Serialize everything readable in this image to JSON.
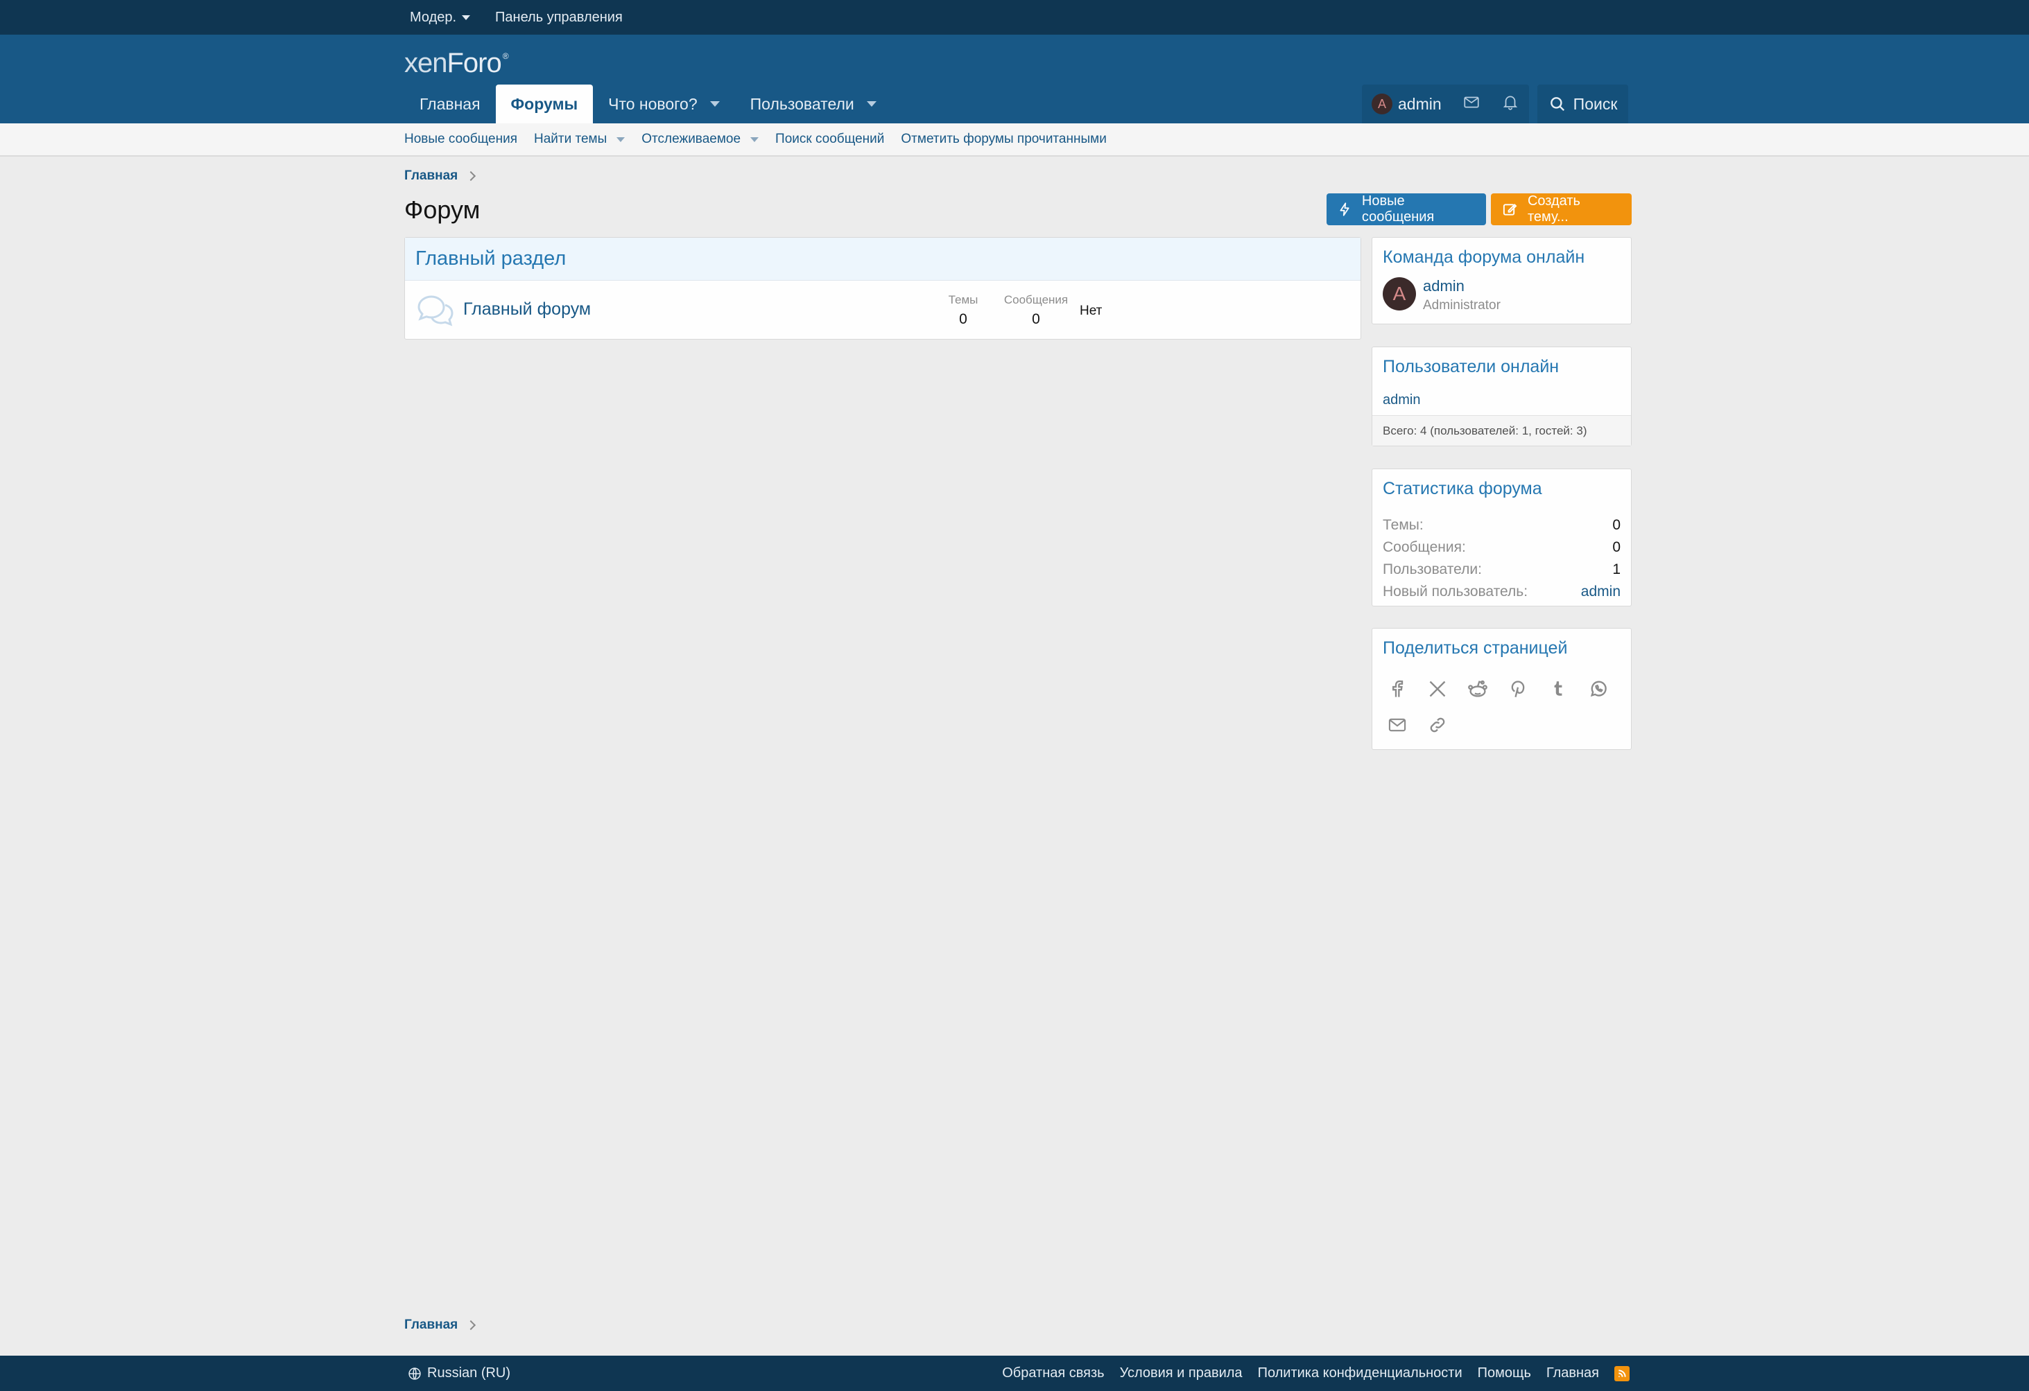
{
  "staff_bar": {
    "moderator": "Модер.",
    "admin_panel": "Панель управления"
  },
  "logo": {
    "part1": "xen",
    "part2": "Foro",
    "mark": "®"
  },
  "nav": {
    "tabs": [
      {
        "label": "Главная",
        "active": false,
        "dropdown": false
      },
      {
        "label": "Форумы",
        "active": true,
        "dropdown": false
      },
      {
        "label": "Что нового?",
        "active": false,
        "dropdown": true
      },
      {
        "label": "Пользователи",
        "active": false,
        "dropdown": true
      }
    ],
    "user": {
      "avatar_letter": "A",
      "name": "admin"
    },
    "search_label": "Поиск"
  },
  "subnav": {
    "items": [
      {
        "label": "Новые сообщения",
        "dropdown": false
      },
      {
        "label": "Найти темы",
        "dropdown": true
      },
      {
        "label": "Отслеживаемое",
        "dropdown": true
      },
      {
        "label": "Поиск сообщений",
        "dropdown": false
      },
      {
        "label": "Отметить форумы прочитанными",
        "dropdown": false
      }
    ]
  },
  "breadcrumb": {
    "home": "Главная"
  },
  "page": {
    "title": "Форум",
    "new_posts_button": "Новые сообщения",
    "create_thread_button": "Создать тему..."
  },
  "category": {
    "title": "Главный раздел",
    "forums": [
      {
        "title": "Главный форум",
        "threads_label": "Темы",
        "threads": "0",
        "messages_label": "Сообщения",
        "messages": "0",
        "last_post": "Нет"
      }
    ]
  },
  "sidebar": {
    "staff": {
      "title": "Команда форума онлайн",
      "member": {
        "avatar_letter": "A",
        "name": "admin",
        "role": "Administrator"
      }
    },
    "online": {
      "title": "Пользователи онлайн",
      "users": "admin",
      "total": "Всего: 4 (пользователей: 1, гостей: 3)"
    },
    "stats": {
      "title": "Статистика форума",
      "rows": [
        {
          "label": "Темы:",
          "value": "0"
        },
        {
          "label": "Сообщения:",
          "value": "0"
        },
        {
          "label": "Пользователи:",
          "value": "1"
        },
        {
          "label": "Новый пользователь:",
          "value": "admin"
        }
      ]
    },
    "share": {
      "title": "Поделиться страницей",
      "icons": [
        "facebook-icon",
        "x-icon",
        "reddit-icon",
        "pinterest-icon",
        "tumblr-icon",
        "whatsapp-icon",
        "email-icon",
        "link-icon"
      ]
    }
  },
  "footer": {
    "language": "Russian (RU)",
    "links": [
      "Обратная связь",
      "Условия и правила",
      "Политика конфиденциальности",
      "Помощь",
      "Главная"
    ]
  },
  "colors": {
    "header": "#185886",
    "staff_bar": "#0f3652",
    "accent_blue": "#2577b1",
    "accent_orange": "#f2930d",
    "page_bg": "#ececec"
  }
}
